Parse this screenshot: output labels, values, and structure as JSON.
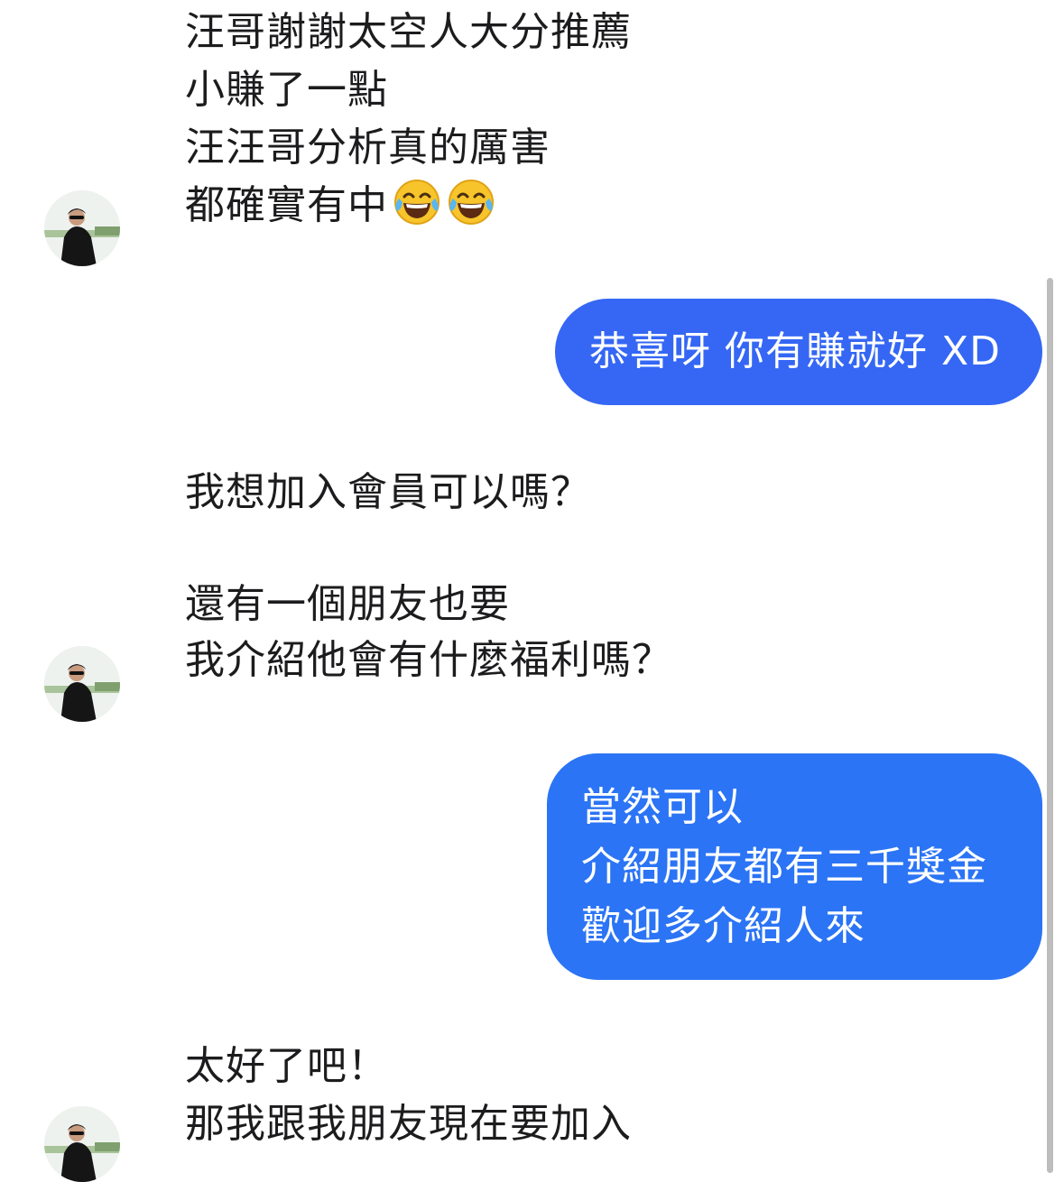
{
  "conversation": {
    "messages": [
      {
        "sender": "contact",
        "lines": [
          "汪哥謝謝太空人大分推薦",
          "小賺了一點",
          "汪汪哥分析真的厲害",
          "都確實有中"
        ],
        "trailing_emoji": [
          "face-with-tears-of-joy",
          "face-with-tears-of-joy"
        ]
      },
      {
        "sender": "me",
        "lines": [
          "恭喜呀 你有賺就好 XD"
        ],
        "bubble_color": "#3567f4"
      },
      {
        "sender": "contact",
        "lines": [
          "我想加入會員可以嗎？",
          "",
          "還有一個朋友也要",
          "我介紹他會有什麼福利嗎？"
        ]
      },
      {
        "sender": "me",
        "lines": [
          "當然可以",
          "介紹朋友都有三千獎金",
          "歡迎多介紹人來"
        ],
        "bubble_color": "#2b74f5"
      },
      {
        "sender": "contact",
        "lines": [
          "太好了吧！",
          "那我跟我朋友現在要加入"
        ]
      }
    ]
  },
  "colors": {
    "outgoing_bubble": "#3567f4",
    "outgoing_bubble_alt": "#2b74f5",
    "incoming_text": "#1c1c1e",
    "scrollbar": "#bdbdbd"
  }
}
